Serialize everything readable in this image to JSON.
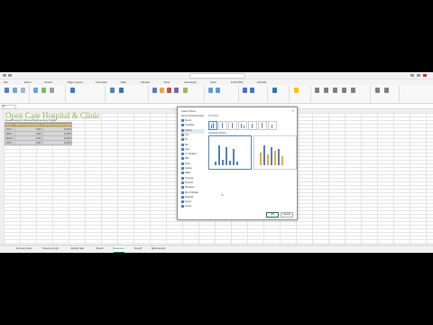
{
  "app": {
    "title": "BloodRecords"
  },
  "tabs": [
    "File",
    "Home",
    "Insert",
    "Page Layout",
    "Formulas",
    "Data",
    "Review",
    "View",
    "Developer",
    "Help",
    "Foxit PDF",
    "Acrobat"
  ],
  "active_tab": "Insert",
  "name_box": "A3",
  "sheet": {
    "title": "Open Care Hospital & Clinic",
    "subtitle": "Department of Clinical Biochemistry Study",
    "headers": [
      "Month",
      "Blood Samples Collected",
      "Samples Processed (Total)"
    ],
    "rows": [
      [
        "JAN 1",
        "1,009",
        "14,609"
      ],
      [
        "FEB 1",
        "1,009",
        "14,609"
      ],
      [
        "MAR 1",
        "1,009",
        "14,609"
      ],
      [
        "APR 1",
        "1,009",
        "14,609"
      ]
    ]
  },
  "sheet_tabs": [
    "Summary sheet",
    "Revenue by Qtr",
    "Monthly data",
    "Sheet3",
    "Breakdown",
    "Sheet5",
    "Blood records"
  ],
  "active_sheet_tab": "Breakdown",
  "dialog": {
    "title": "Insert Chart",
    "close": "×",
    "tabs": [
      "Recommended Charts",
      "All Charts"
    ],
    "active_tab": "All Charts",
    "chart_types": [
      "Recent",
      "Templates",
      "Column",
      "Line",
      "Pie",
      "Bar",
      "Area",
      "X Y (Scatter)",
      "Map",
      "Stock",
      "Surface",
      "Radar",
      "Treemap",
      "Sunburst",
      "Histogram",
      "Box & Whisker",
      "Waterfall",
      "Funnel",
      "Combo"
    ],
    "selected_type": "Column",
    "variant_label": "Clustered Column",
    "ok": "OK",
    "cancel": "Cancel"
  },
  "colors": {
    "accent": "#217346",
    "title": "#8fb04a",
    "header_fill": "#c39a42",
    "series_a": "#4f81bd",
    "series_b": "#f0a830"
  }
}
